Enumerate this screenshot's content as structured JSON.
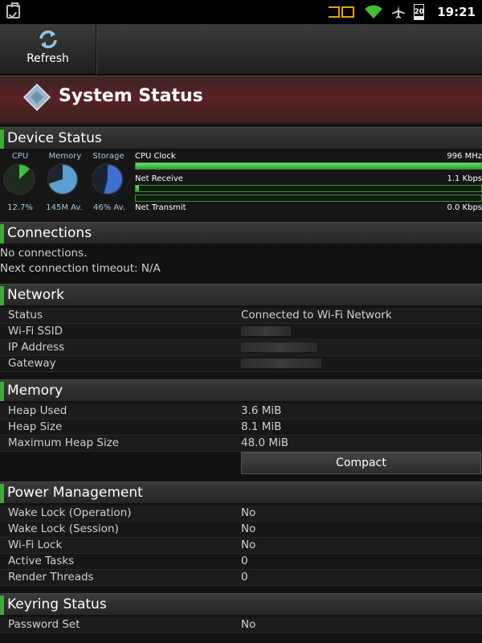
{
  "status_bar": {
    "time": "19:21",
    "battery": "20"
  },
  "toolbar": {
    "refresh_label": "Refresh"
  },
  "banner": {
    "title": "System Status"
  },
  "device_status": {
    "header": "Device Status",
    "gauges": [
      {
        "label": "CPU",
        "value": "12.7%",
        "fraction": 0.127,
        "color": "#3fbf3f"
      },
      {
        "label": "Memory",
        "value": "145M Av.",
        "fraction": 0.7,
        "color": "#5b9fcf"
      },
      {
        "label": "Storage",
        "value": "46% Av.",
        "fraction": 0.54,
        "color": "#3f6fcf"
      }
    ],
    "meters": [
      {
        "label": "CPU Clock",
        "value": "996 MHz",
        "fraction": 1.0
      },
      {
        "label": "Net Receive",
        "value": "1.1 Kbps",
        "fraction": 0.01
      },
      {
        "label": "Net Transmit",
        "value": "0.0 Kbps",
        "fraction": 0.0
      }
    ]
  },
  "connections": {
    "header": "Connections",
    "lines": [
      "No connections.",
      "Next connection timeout: N/A"
    ]
  },
  "network": {
    "header": "Network",
    "rows": [
      {
        "key": "Status",
        "value": "Connected to Wi-Fi Network"
      },
      {
        "key": "Wi-Fi SSID",
        "value": ""
      },
      {
        "key": "IP Address",
        "value": ""
      },
      {
        "key": "Gateway",
        "value": ""
      }
    ]
  },
  "memory": {
    "header": "Memory",
    "rows": [
      {
        "key": "Heap Used",
        "value": "3.6 MiB"
      },
      {
        "key": "Heap Size",
        "value": "8.1 MiB"
      },
      {
        "key": "Maximum Heap Size",
        "value": "48.0 MiB"
      }
    ],
    "compact_label": "Compact"
  },
  "power": {
    "header": "Power Management",
    "rows": [
      {
        "key": "Wake Lock (Operation)",
        "value": "No"
      },
      {
        "key": "Wake Lock (Session)",
        "value": "No"
      },
      {
        "key": "Wi-Fi Lock",
        "value": "No"
      },
      {
        "key": "Active Tasks",
        "value": "0"
      },
      {
        "key": "Render Threads",
        "value": "0"
      }
    ]
  },
  "keyring": {
    "header": "Keyring Status",
    "rows": [
      {
        "key": "Password Set",
        "value": "No"
      }
    ]
  }
}
